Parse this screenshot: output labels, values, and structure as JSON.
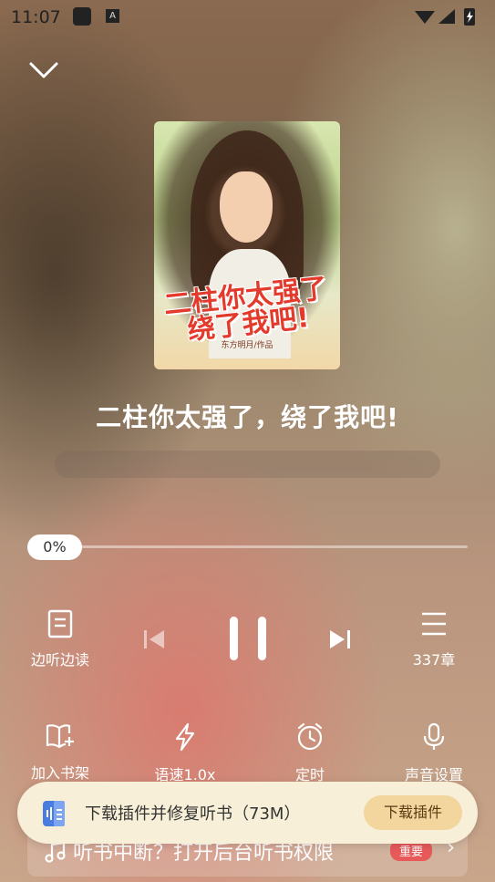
{
  "status_bar": {
    "time": "11:07",
    "app_badge": "A"
  },
  "book": {
    "title": "二柱你太强了，绕了我吧!",
    "cover_title": "二柱你太强了绕了我吧!",
    "cover_author": "东方明月/作品"
  },
  "player": {
    "progress": "0%",
    "progress_fraction": 0.0,
    "read_along_label": "边听边读",
    "chapters_label": "337章"
  },
  "tools": {
    "add_shelf": "加入书架",
    "speed": "语速1.0x",
    "timer": "定时",
    "voice_settings": "声音设置"
  },
  "notice_row": {
    "text": "听书中断？打开后台听书权限",
    "badge": "重要"
  },
  "banner": {
    "text": "下载插件并修复听书（73M）",
    "button": "下载插件"
  }
}
